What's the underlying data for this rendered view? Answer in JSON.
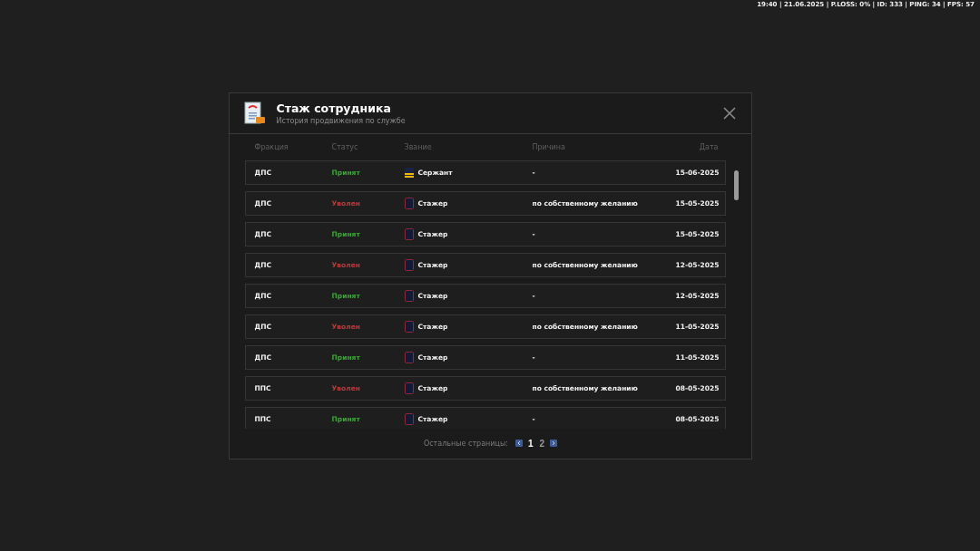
{
  "hud": {
    "stats": "19:40 | 21.06.2025 | P.LOSS: 0% | ID: 333 | PING: 34 | FPS: 57"
  },
  "dialog": {
    "title": "Стаж сотрудника",
    "subtitle": "История продвижения по службе",
    "columns": [
      "Фракция",
      "Статус",
      "Звание",
      "Причина",
      "Дата"
    ],
    "rows": [
      {
        "faction": "ДПС",
        "status": {
          "label": "Принят",
          "kind": "accepted"
        },
        "rank": {
          "label": "Сержант",
          "kind": "sergeant"
        },
        "reason": "-",
        "date": "15-06-2025"
      },
      {
        "faction": "ДПС",
        "status": {
          "label": "Уволен",
          "kind": "fired"
        },
        "rank": {
          "label": "Стажер",
          "kind": "trainee"
        },
        "reason": "по собственному желанию",
        "date": "15-05-2025"
      },
      {
        "faction": "ДПС",
        "status": {
          "label": "Принят",
          "kind": "accepted"
        },
        "rank": {
          "label": "Стажер",
          "kind": "trainee"
        },
        "reason": "-",
        "date": "15-05-2025"
      },
      {
        "faction": "ДПС",
        "status": {
          "label": "Уволен",
          "kind": "fired"
        },
        "rank": {
          "label": "Стажер",
          "kind": "trainee"
        },
        "reason": "по собственному желанию",
        "date": "12-05-2025"
      },
      {
        "faction": "ДПС",
        "status": {
          "label": "Принят",
          "kind": "accepted"
        },
        "rank": {
          "label": "Стажер",
          "kind": "trainee"
        },
        "reason": "-",
        "date": "12-05-2025"
      },
      {
        "faction": "ДПС",
        "status": {
          "label": "Уволен",
          "kind": "fired"
        },
        "rank": {
          "label": "Стажер",
          "kind": "trainee"
        },
        "reason": "по собственному желанию",
        "date": "11-05-2025"
      },
      {
        "faction": "ДПС",
        "status": {
          "label": "Принят",
          "kind": "accepted"
        },
        "rank": {
          "label": "Стажер",
          "kind": "trainee"
        },
        "reason": "-",
        "date": "11-05-2025"
      },
      {
        "faction": "ППС",
        "status": {
          "label": "Уволен",
          "kind": "fired"
        },
        "rank": {
          "label": "Стажер",
          "kind": "trainee"
        },
        "reason": "по собственному желанию",
        "date": "08-05-2025"
      },
      {
        "faction": "ППС",
        "status": {
          "label": "Принят",
          "kind": "accepted"
        },
        "rank": {
          "label": "Стажер",
          "kind": "trainee"
        },
        "reason": "-",
        "date": "08-05-2025"
      }
    ],
    "pagination": {
      "label": "Остальные страницы:",
      "pages": [
        {
          "label": "1",
          "selected": true
        },
        {
          "label": "2",
          "selected": false
        }
      ]
    }
  }
}
